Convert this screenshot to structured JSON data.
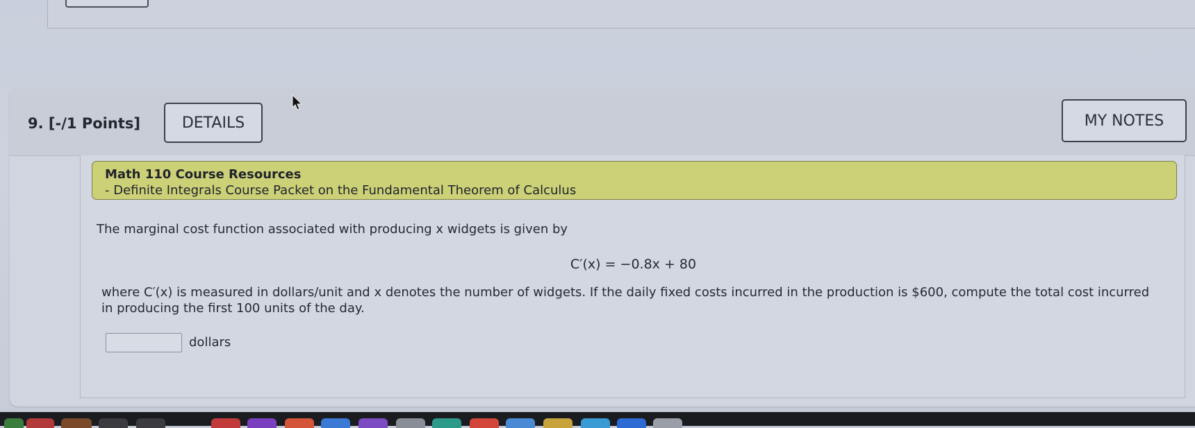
{
  "question": {
    "number_label": "9.",
    "points_label": "[-/1 Points]",
    "details_label": "DETAILS",
    "my_notes_label": "MY NOTES"
  },
  "resources": {
    "title": "Math 110 Course Resources",
    "link": "- Definite Integrals Course Packet on the Fundamental Theorem of Calculus"
  },
  "problem": {
    "intro": "The marginal cost function associated with producing x widgets is given by",
    "formula": "C′(x) = −0.8x + 80",
    "body": "where C′(x) is measured in dollars/unit and x denotes the number of widgets. If the daily fixed costs incurred in the production is $600, compute the total cost incurred in producing the first 100 units of the day.",
    "answer_value": "",
    "answer_units": "dollars"
  },
  "colors": {
    "resources_bg": "#ccd178",
    "page_bg": "#c9cfdc"
  },
  "icons": {
    "cursor": "mouse-pointer-icon"
  }
}
